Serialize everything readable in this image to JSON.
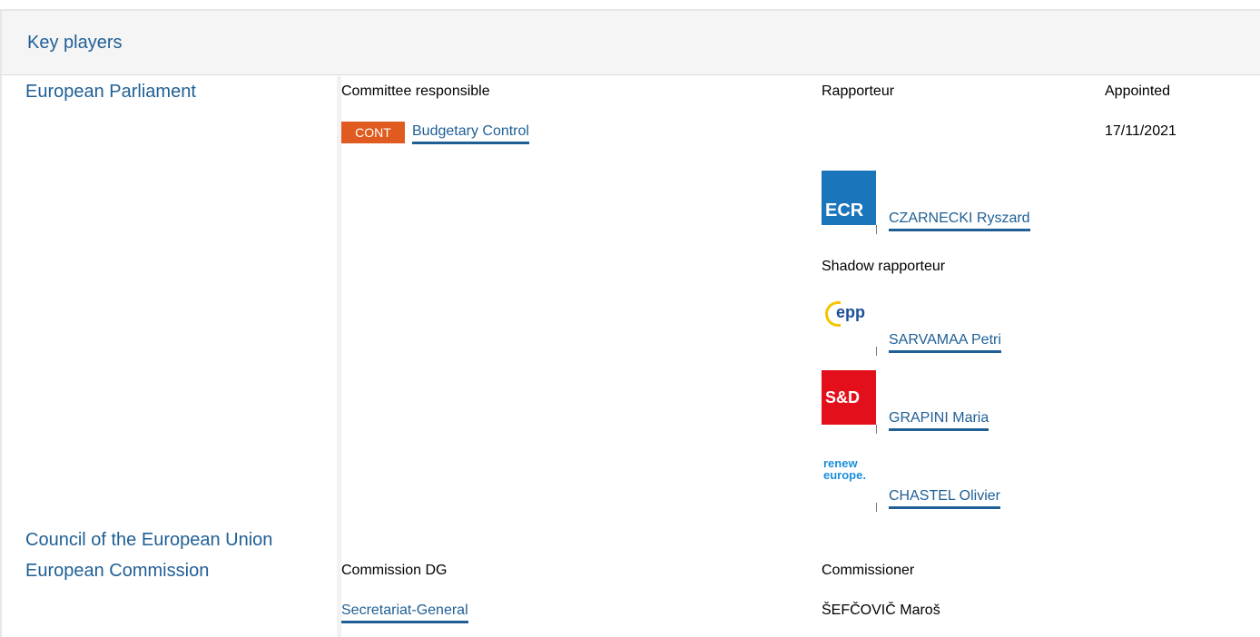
{
  "header": {
    "title": "Key players"
  },
  "european_parliament": {
    "name": "European Parliament",
    "committee_label": "Committee responsible",
    "rapporteur_label": "Rapporteur",
    "appointed_label": "Appointed",
    "committee_code": "CONT",
    "committee_name": "Budgetary Control",
    "appointed_date": "17/11/2021",
    "rapporteur": {
      "group_logo": "ECR",
      "name": "CZARNECKI Ryszard"
    },
    "shadow_label": "Shadow rapporteur",
    "shadows": [
      {
        "group_logo": "epp",
        "name": "SARVAMAA Petri"
      },
      {
        "group_logo": "S&D",
        "name": "GRAPINI Maria"
      },
      {
        "group_logo": "renew europe.",
        "name": "CHASTEL Olivier"
      }
    ],
    "badge_color": "#e05b1f"
  },
  "council": {
    "name": "Council of the European Union"
  },
  "commission": {
    "name": "European Commission",
    "dg_label": "Commission DG",
    "commissioner_label": "Commissioner",
    "dg_name": "Secretariat-General",
    "commissioner_name": "ŠEFČOVIČ Maroš"
  },
  "colors": {
    "link": "#1f5f95",
    "header_bg": "#f5f5f5"
  }
}
